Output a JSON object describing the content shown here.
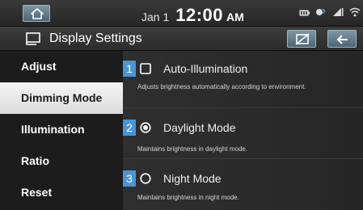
{
  "status_bar": {
    "date": "Jan 1",
    "time": "12:00",
    "ampm": "AM",
    "icons": [
      "home-icon",
      "battery-icon",
      "bluetooth-icon",
      "signal-icon",
      "wifi-icon"
    ]
  },
  "title_bar": {
    "title": "Display Settings",
    "icon": "display-icon",
    "screen_off_icon": "screen-off-icon",
    "back_icon": "back-arrow-icon"
  },
  "sidebar": {
    "items": [
      {
        "label": "Adjust",
        "active": false
      },
      {
        "label": "Dimming Mode",
        "active": true
      },
      {
        "label": "Illumination",
        "active": false
      },
      {
        "label": "Ratio",
        "active": false
      },
      {
        "label": "Reset",
        "active": false
      }
    ]
  },
  "options": [
    {
      "number": "1",
      "type": "checkbox",
      "label": "Auto-Illumination",
      "checked": false,
      "description": "Adjusts brightness automatically according to environment."
    },
    {
      "number": "2",
      "type": "radio",
      "label": "Daylight Mode",
      "checked": true,
      "description": "Maintains brightness in daylight mode."
    },
    {
      "number": "3",
      "type": "radio",
      "label": "Night Mode",
      "checked": false,
      "description": "Maintains brightness in night mode."
    }
  ],
  "colors": {
    "accent": "#4a95d6",
    "button": "#5f7684",
    "background": "#1c1c1c"
  }
}
